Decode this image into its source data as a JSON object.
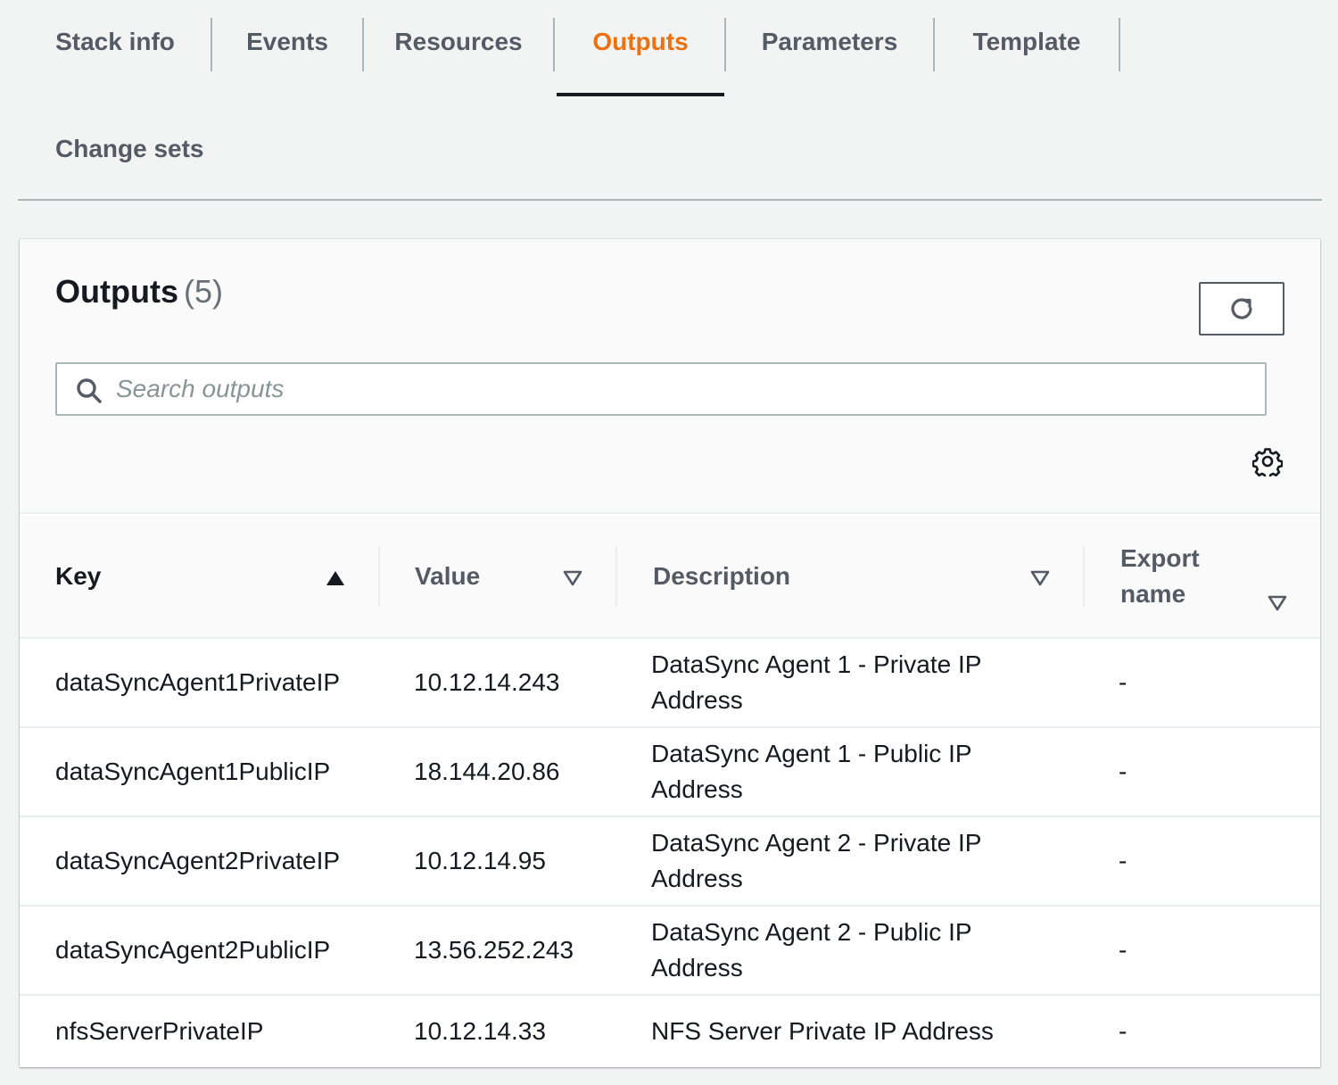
{
  "tabs": [
    {
      "label": "Stack info",
      "active": false
    },
    {
      "label": "Events",
      "active": false
    },
    {
      "label": "Resources",
      "active": false
    },
    {
      "label": "Outputs",
      "active": true
    },
    {
      "label": "Parameters",
      "active": false
    },
    {
      "label": "Template",
      "active": false
    },
    {
      "label": "Change sets",
      "active": false
    }
  ],
  "panel": {
    "title": "Outputs",
    "count": "(5)",
    "search_placeholder": "Search outputs",
    "refresh_icon": "refresh-icon",
    "settings_icon": "gear-icon"
  },
  "table": {
    "columns": [
      {
        "label": "Key",
        "sort": "ascending"
      },
      {
        "label": "Value",
        "sort": "none"
      },
      {
        "label": "Description",
        "sort": "none"
      },
      {
        "label": "Export name",
        "line1": "Export",
        "line2": "name",
        "sort": "none"
      }
    ],
    "rows": [
      {
        "key": "dataSyncAgent1PrivateIP",
        "value": "10.12.14.243",
        "description": "DataSync Agent 1 - Private IP Address",
        "export": "-"
      },
      {
        "key": "dataSyncAgent1PublicIP",
        "value": "18.144.20.86",
        "description": "DataSync Agent 1 - Public IP Address",
        "export": "-"
      },
      {
        "key": "dataSyncAgent2PrivateIP",
        "value": "10.12.14.95",
        "description": "DataSync Agent 2 - Private IP Address",
        "export": "-"
      },
      {
        "key": "dataSyncAgent2PublicIP",
        "value": "13.56.252.243",
        "description": "DataSync Agent 2 - Public IP Address",
        "export": "-"
      },
      {
        "key": "nfsServerPrivateIP",
        "value": "10.12.14.33",
        "description": "NFS Server Private IP Address",
        "export": "-"
      }
    ]
  },
  "colors": {
    "accent": "#ec7211",
    "text": "#16191f",
    "muted": "#545b64",
    "background": "#f2f3f3"
  }
}
